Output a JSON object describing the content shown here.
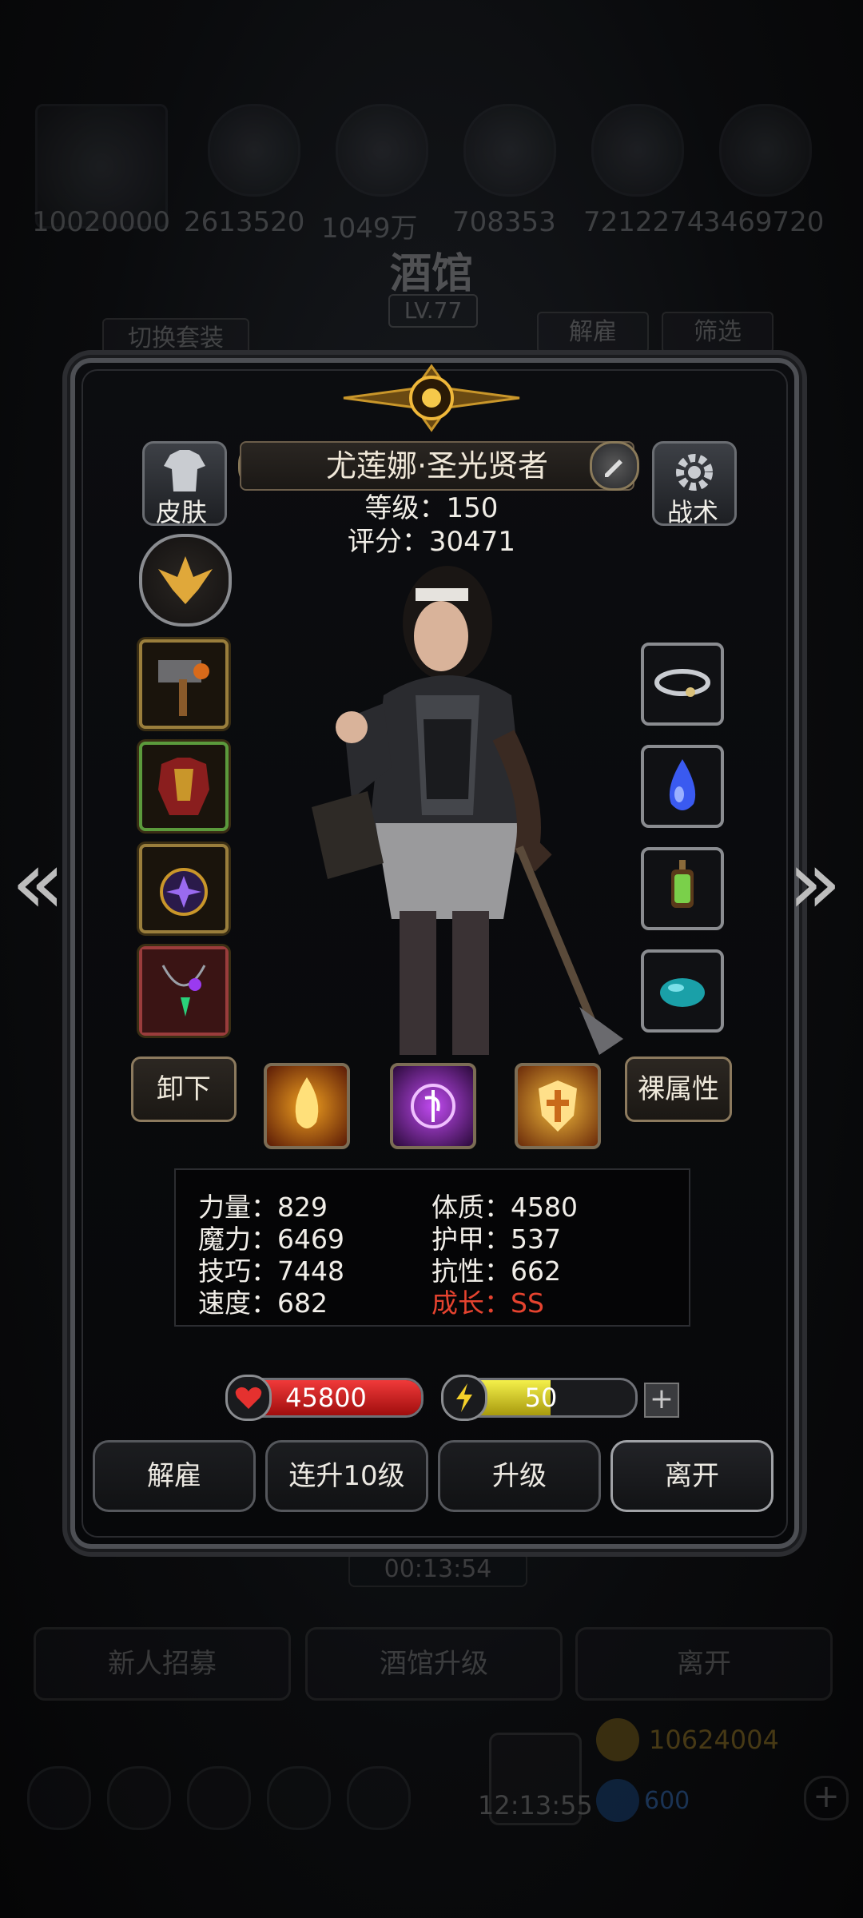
{
  "background": {
    "title": "酒馆",
    "level": "LV.77",
    "switch_outfit": "切换套装",
    "dismiss_tab": "解雇",
    "filter_tab": "筛选",
    "resources": [
      "10020000",
      "2613520",
      "1049万",
      "708353",
      "7212274",
      "3469720"
    ],
    "timer": "00:13:54",
    "buttons": [
      "新人招募",
      "酒馆升级",
      "离开"
    ],
    "gold": "10624004",
    "gems": "600",
    "clock": "12:13:55"
  },
  "hero": {
    "name": "尤莲娜·圣光贤者",
    "level_text": "等级：150",
    "score_text": "评分：30471",
    "skin_label": "皮肤",
    "tactics_label": "战术",
    "unequip_label": "卸下",
    "bare_attr_label": "裸属性"
  },
  "stats": {
    "left": [
      "力量：829",
      "魔力：6469",
      "技巧：7448",
      "速度：682"
    ],
    "right": [
      "体质：4580",
      "护甲：537",
      "抗性：662"
    ],
    "growth": "成长：SS",
    "growth_color": "#e5432f"
  },
  "bars": {
    "hp": "45800",
    "energy": "50",
    "energy_fill_percent": 55
  },
  "actions": [
    "解雇",
    "连升10级",
    "升级",
    "离开"
  ],
  "nav": {
    "prev": "«",
    "next": "»"
  },
  "icons": {
    "equipment": [
      "hammer-icon",
      "armor-icon",
      "amulet-icon",
      "necklace-icon"
    ],
    "accessories": [
      "ring-icon",
      "crystal-drop-icon",
      "lantern-icon",
      "gem-icon"
    ],
    "skills": [
      "fire-skill-icon",
      "arcane-skill-icon",
      "holy-shield-skill-icon"
    ]
  }
}
